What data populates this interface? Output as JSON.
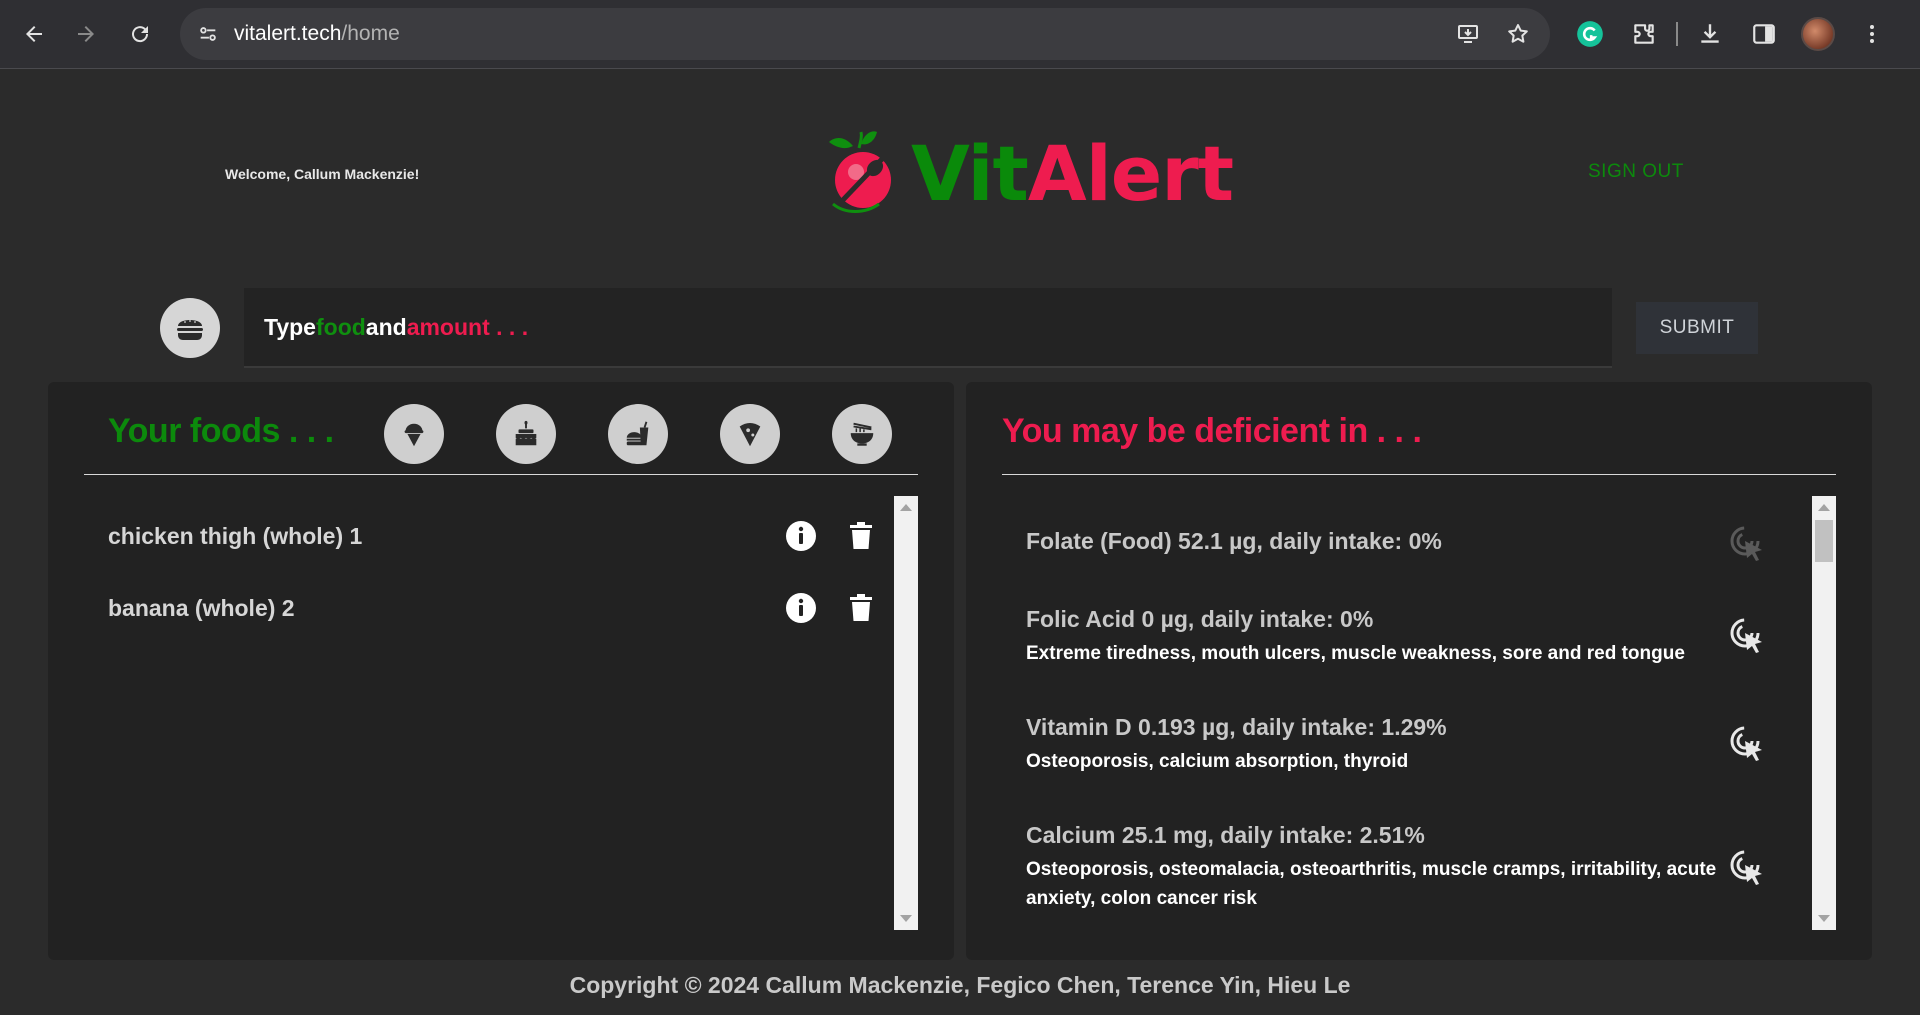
{
  "browser": {
    "url_host": "vitalert.tech",
    "url_path": "/home",
    "icons": [
      "back-icon",
      "forward-icon",
      "reload-icon",
      "site-settings-icon",
      "install-app-icon",
      "bookmark-star-icon",
      "grammarly-icon",
      "extensions-icon",
      "download-icon",
      "side-panel-icon",
      "profile-avatar",
      "menu-icon"
    ]
  },
  "header": {
    "welcome": "Welcome, Callum Mackenzie!",
    "logo_vit": "Vit",
    "logo_alert": "Alert",
    "sign_out": "SIGN OUT"
  },
  "search": {
    "placeholder_type": "Type ",
    "placeholder_food": "food",
    "placeholder_and": " and ",
    "placeholder_amount": "amount . . .",
    "submit": "SUBMIT"
  },
  "foods_panel": {
    "title": "Your foods . . .",
    "category_icons": [
      "ice-cream-icon",
      "cake-icon",
      "fast-food-icon",
      "pizza-icon",
      "noodle-bowl-icon"
    ],
    "items": [
      {
        "name": "chicken thigh (whole) 1"
      },
      {
        "name": "banana (whole) 2"
      }
    ]
  },
  "deficiency_panel": {
    "title": "You may be deficient in . . .",
    "items": [
      {
        "title": "Folate (Food) 52.1 µg, daily intake: 0%",
        "symptoms": ""
      },
      {
        "title": "Folic Acid 0 µg, daily intake: 0%",
        "symptoms": "Extreme tiredness, mouth ulcers, muscle weakness, sore and red tongue"
      },
      {
        "title": "Vitamin D 0.193 µg, daily intake: 1.29%",
        "symptoms": "Osteoporosis, calcium absorption, thyroid"
      },
      {
        "title": "Calcium 25.1 mg, daily intake: 2.51%",
        "symptoms": "Osteoporosis, osteomalacia, osteoarthritis, muscle cramps, irritability, acute anxiety, colon cancer risk"
      }
    ]
  },
  "footer": {
    "copyright": "Copyright © 2024 Callum Mackenzie, Fegico Chen, Terence Yin, Hieu Le"
  },
  "colors": {
    "brand_green": "#0c8a0c",
    "brand_red": "#ee1c4f",
    "background": "#2b2b2b",
    "panel": "#222222"
  }
}
